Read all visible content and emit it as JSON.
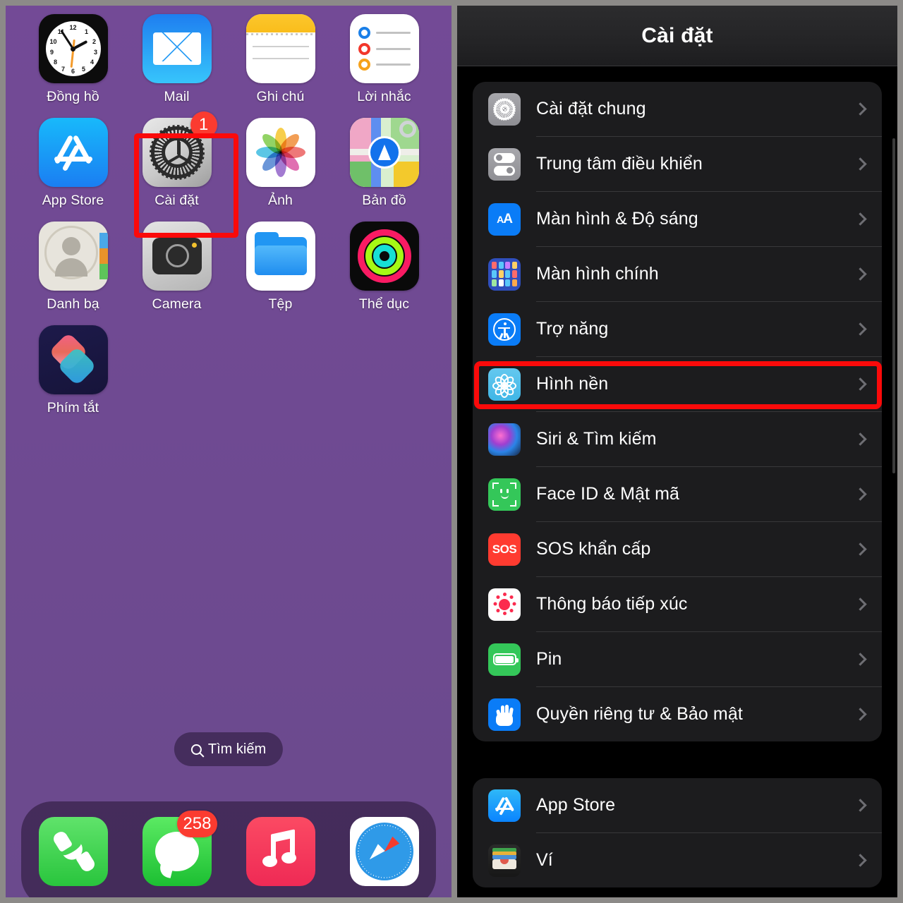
{
  "home_screen": {
    "apps": [
      {
        "label": "Đồng hồ",
        "icon": "clock-icon"
      },
      {
        "label": "Mail",
        "icon": "mail-icon"
      },
      {
        "label": "Ghi chú",
        "icon": "notes-icon"
      },
      {
        "label": "Lời nhắc",
        "icon": "reminders-icon"
      },
      {
        "label": "App Store",
        "icon": "app-store-icon"
      },
      {
        "label": "Cài đặt",
        "icon": "settings-gear-icon",
        "badge": "1",
        "highlighted": true
      },
      {
        "label": "Ảnh",
        "icon": "photos-icon"
      },
      {
        "label": "Bản đồ",
        "icon": "maps-icon"
      },
      {
        "label": "Danh bạ",
        "icon": "contacts-icon"
      },
      {
        "label": "Camera",
        "icon": "camera-icon"
      },
      {
        "label": "Tệp",
        "icon": "files-folder-icon"
      },
      {
        "label": "Thể dục",
        "icon": "fitness-rings-icon"
      },
      {
        "label": "Phím tắt",
        "icon": "shortcuts-icon"
      }
    ],
    "search": {
      "label": "Tìm kiếm",
      "icon": "search-icon"
    },
    "dock": [
      {
        "name": "Phone",
        "icon": "phone-handset-icon"
      },
      {
        "name": "Messages",
        "icon": "message-bubble-icon",
        "badge": "258"
      },
      {
        "name": "Music",
        "icon": "music-note-icon"
      },
      {
        "name": "Safari",
        "icon": "safari-compass-icon"
      }
    ],
    "highlight_color": "#fb0a0a",
    "wallpaper_color": "#734a96"
  },
  "settings_screen": {
    "title": "Cài đặt",
    "groups": [
      {
        "rows": [
          {
            "label": "Cài đặt chung",
            "icon": "gear-icon"
          },
          {
            "label": "Trung tâm điều khiển",
            "icon": "control-center-icon"
          },
          {
            "label": "Màn hình & Độ sáng",
            "icon": "display-brightness-icon"
          },
          {
            "label": "Màn hình chính",
            "icon": "home-screen-icon"
          },
          {
            "label": "Trợ năng",
            "icon": "accessibility-icon"
          },
          {
            "label": "Hình nền",
            "icon": "wallpaper-icon",
            "highlighted": true
          },
          {
            "label": "Siri & Tìm kiếm",
            "icon": "siri-icon"
          },
          {
            "label": "Face ID & Mật mã",
            "icon": "face-id-icon"
          },
          {
            "label": "SOS khẩn cấp",
            "icon": "sos-icon"
          },
          {
            "label": "Thông báo tiếp xúc",
            "icon": "exposure-notification-icon"
          },
          {
            "label": "Pin",
            "icon": "battery-icon"
          },
          {
            "label": "Quyền riêng tư & Bảo mật",
            "icon": "privacy-hand-icon"
          }
        ]
      },
      {
        "rows": [
          {
            "label": "App Store",
            "icon": "app-store-icon"
          },
          {
            "label": "Ví",
            "icon": "wallet-icon"
          }
        ]
      }
    ],
    "chevron_icon": "chevron-right-icon",
    "highlight_color": "#fb0a0a",
    "background_color": "#000000",
    "card_color": "#1c1c1e"
  }
}
